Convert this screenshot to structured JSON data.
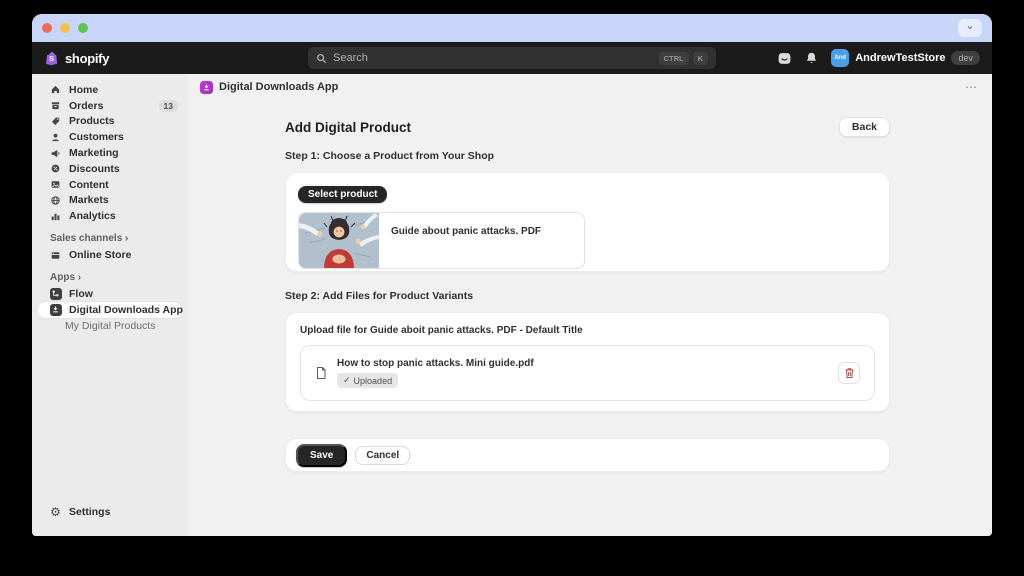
{
  "topbar": {
    "logo_text": "shopify",
    "search": {
      "placeholder": "Search",
      "shortcut_ctrl": "CTRL",
      "shortcut_k": "K"
    },
    "store": {
      "avatar_initials": "And",
      "name": "AndrewTestStore",
      "badge": "dev"
    }
  },
  "sidebar": {
    "items": [
      {
        "label": "Home"
      },
      {
        "label": "Orders",
        "badge": "13"
      },
      {
        "label": "Products"
      },
      {
        "label": "Customers"
      },
      {
        "label": "Marketing"
      },
      {
        "label": "Discounts"
      },
      {
        "label": "Content"
      },
      {
        "label": "Markets"
      },
      {
        "label": "Analytics"
      }
    ],
    "sales_channels_label": "Sales channels",
    "online_store_label": "Online Store",
    "apps_label": "Apps",
    "flow_label": "Flow",
    "digital_downloads_label": "Digital Downloads App",
    "my_digital_products_label": "My Digital Products",
    "settings_label": "Settings"
  },
  "header": {
    "app_title": "Digital Downloads App"
  },
  "main": {
    "page_title": "Add Digital Product",
    "back_button": "Back",
    "step1_title": "Step 1: Choose a Product from Your Shop",
    "select_product_button": "Select product",
    "product_name": "Guide about panic attacks. PDF",
    "step2_title": "Step 2: Add Files for Product Variants",
    "upload_label": "Upload file for Guide aboit panic attacks. PDF - Default Title",
    "file_name": "How to stop panic attacks. Mini guide.pdf",
    "uploaded_badge": "Uploaded",
    "save_button": "Save",
    "cancel_button": "Cancel"
  },
  "icons": {
    "chevron_down": "⌄",
    "overflow_menu": "⋯",
    "section_chevron": "›",
    "check": "✓",
    "gear": "⚙"
  },
  "colors": {
    "titlebar": "#c9d5f8",
    "topbar": "#1b1b1b",
    "sidebar_bg": "#ebebeb",
    "content_bg": "#f1f1f1",
    "app_accent": "#b03ac4",
    "avatar": "#4b9fe8",
    "trash": "#9c5244"
  }
}
